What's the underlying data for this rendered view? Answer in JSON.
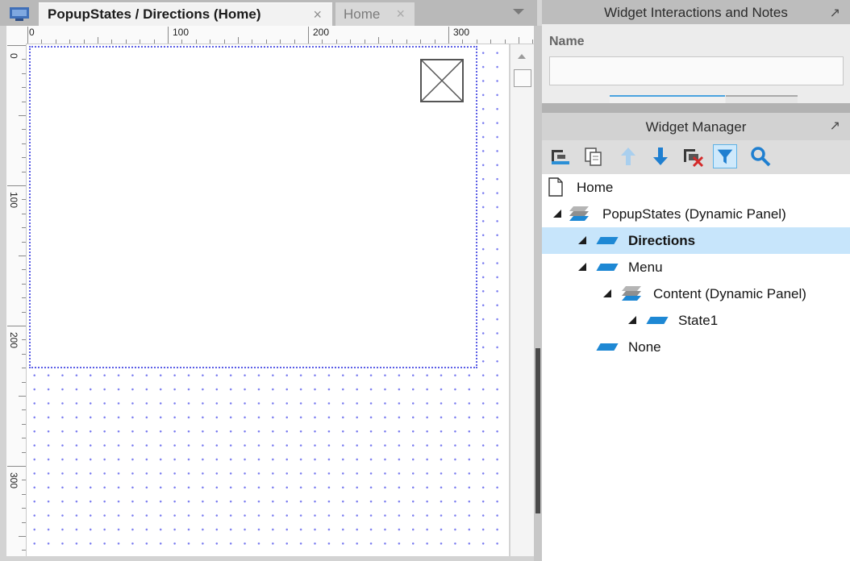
{
  "editor": {
    "tabs": [
      {
        "label": "PopupStates / Directions (Home)",
        "close": "×",
        "active": true
      },
      {
        "label": "Home",
        "close": "×",
        "active": false
      }
    ],
    "ruler": {
      "horizontal_labels": [
        "0",
        "100",
        "200",
        "300"
      ],
      "vertical_labels": [
        "0",
        "100",
        "200",
        "300"
      ]
    }
  },
  "interactions_panel": {
    "title": "Widget Interactions and Notes",
    "pin": "↗",
    "name_label": "Name",
    "name_value": ""
  },
  "widget_manager": {
    "title": "Widget Manager",
    "pin": "↗",
    "toolbar": [
      "add-folder-icon",
      "duplicate-icon",
      "move-up-icon",
      "move-down-icon",
      "delete-icon",
      "filter-icon",
      "search-icon"
    ],
    "tree": [
      {
        "label": "Home",
        "type": "page"
      },
      {
        "label": "PopupStates (Dynamic Panel)",
        "type": "dynamic-panel"
      },
      {
        "label": "Directions",
        "type": "state",
        "selected": true
      },
      {
        "label": "Menu",
        "type": "state"
      },
      {
        "label": "Content (Dynamic Panel)",
        "type": "dynamic-panel"
      },
      {
        "label": "State1",
        "type": "state"
      },
      {
        "label": "None",
        "type": "state"
      }
    ]
  },
  "colors": {
    "selection": "#c7e5fb",
    "state_icon": "#1e88d4",
    "panel_border": "#5b5ee6"
  }
}
